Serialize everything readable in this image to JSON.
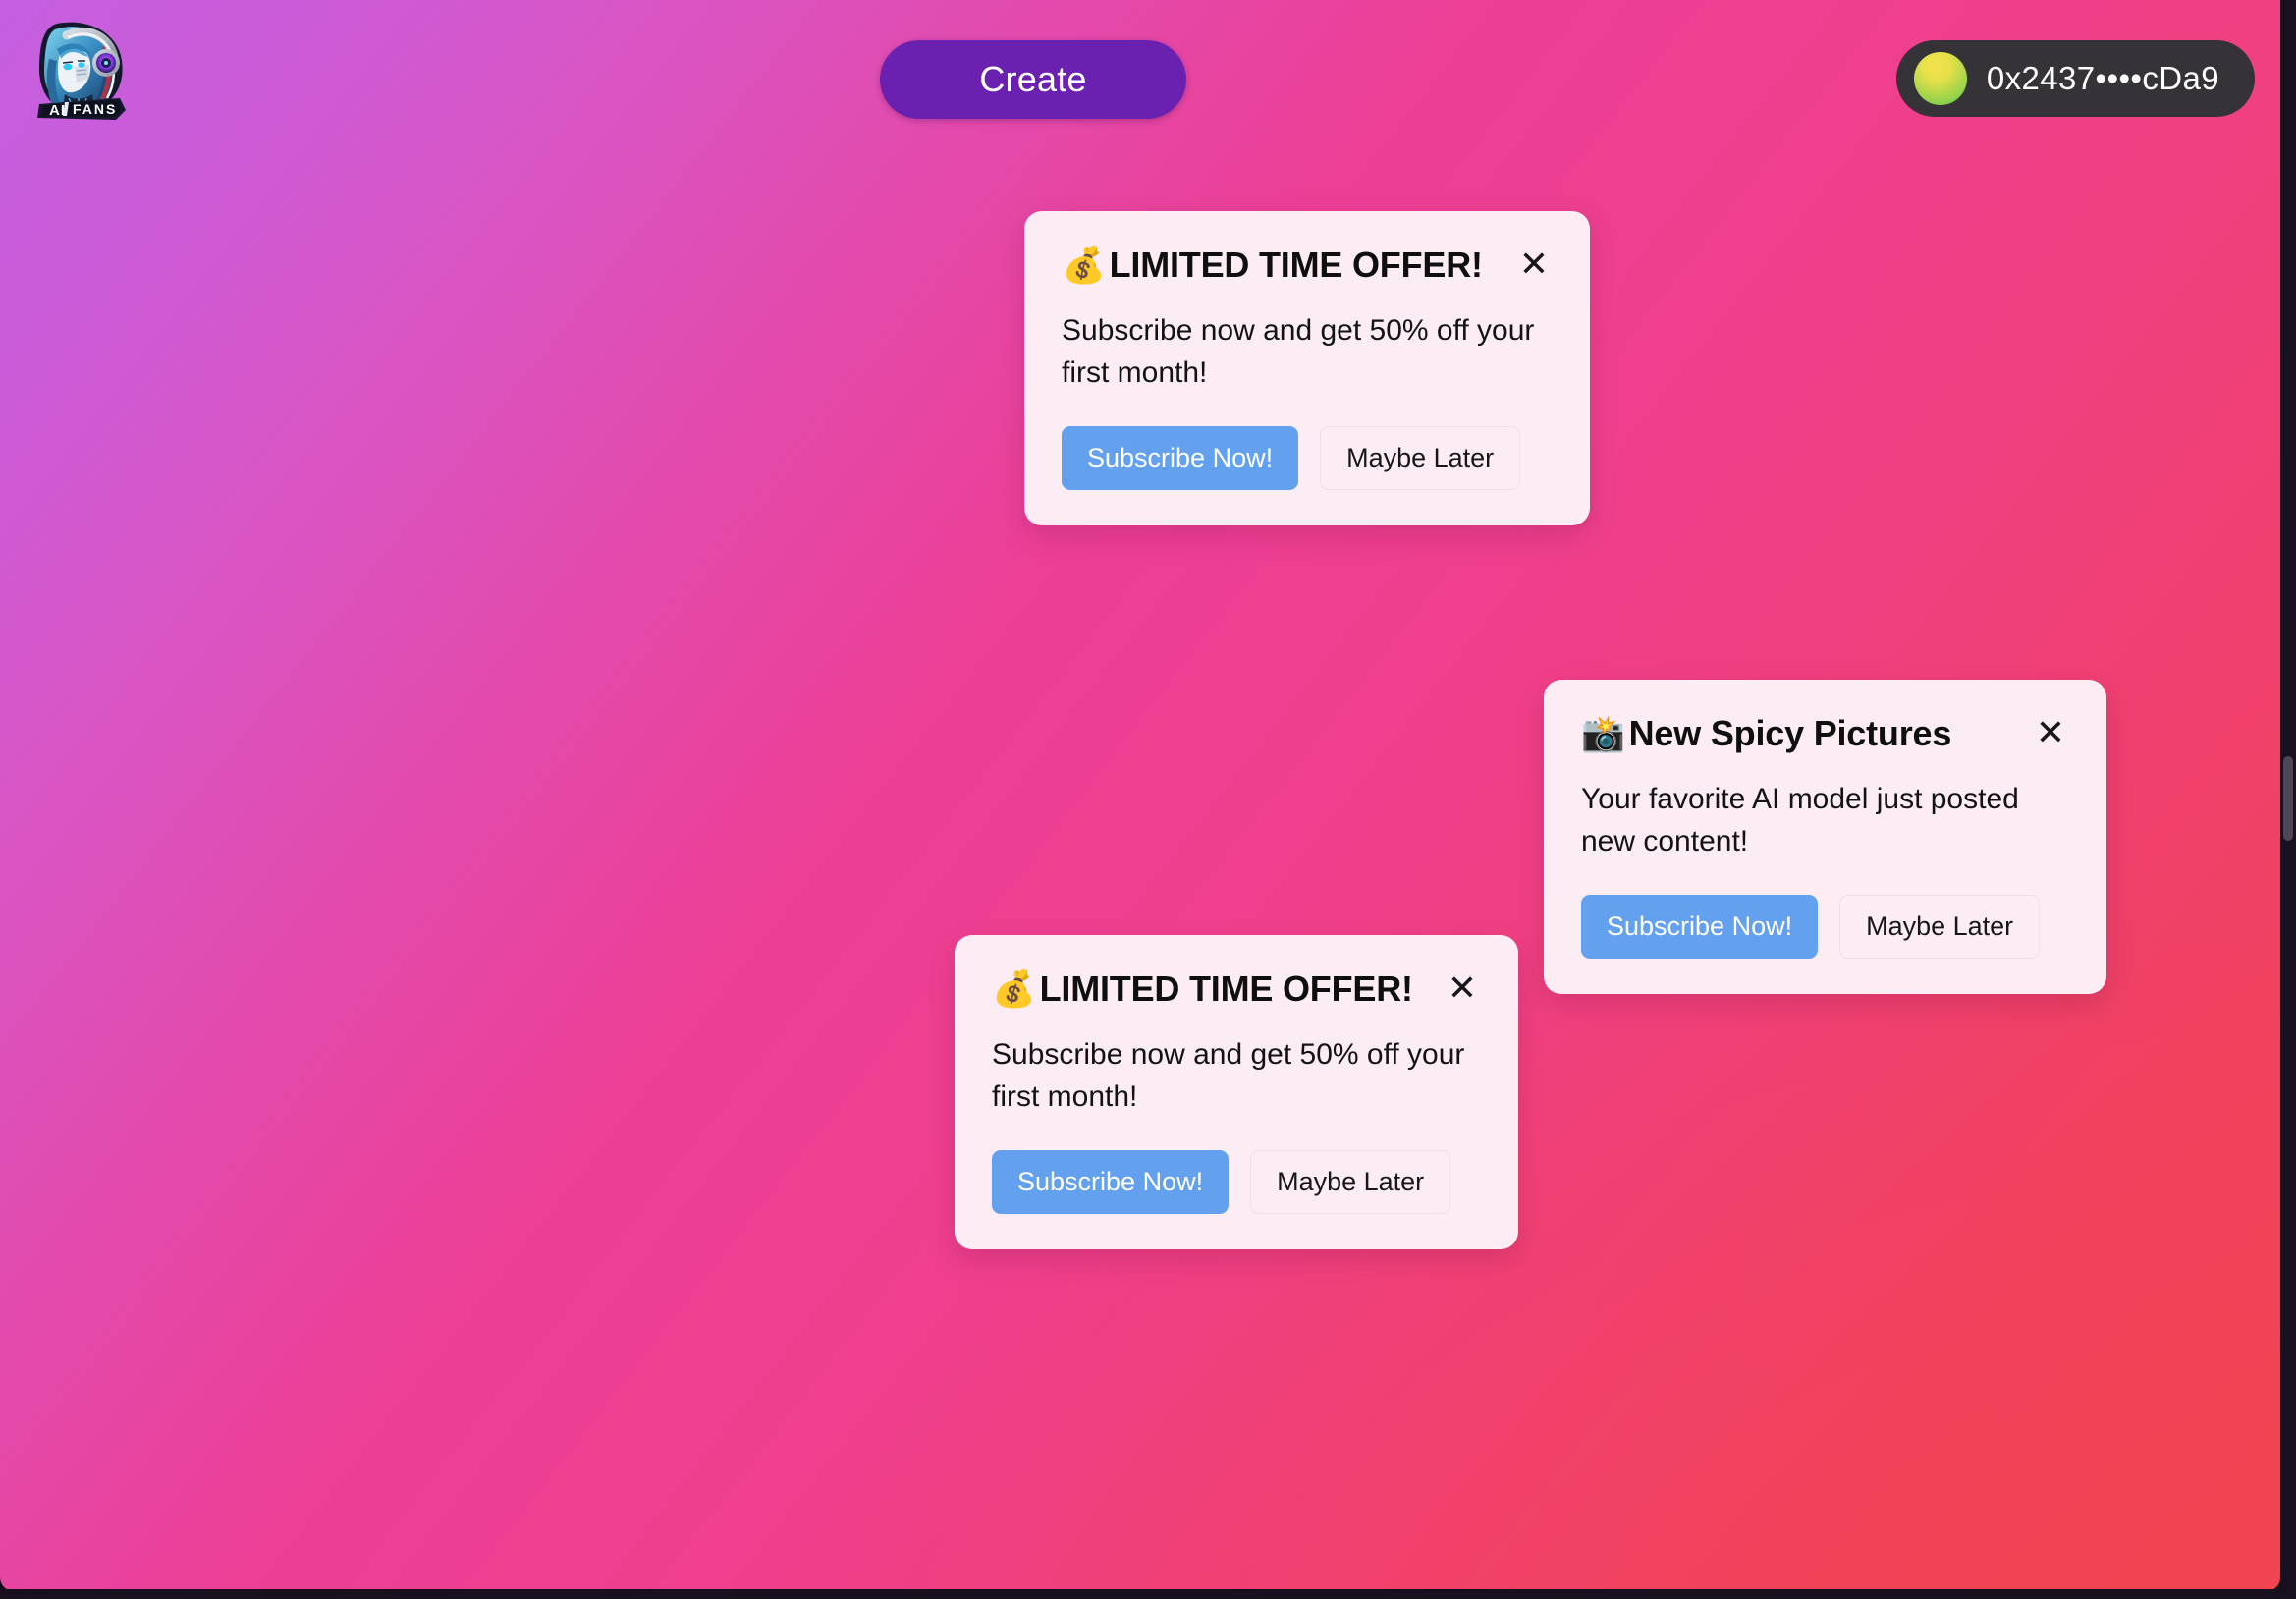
{
  "header": {
    "logo": {
      "icon": "ai-fans-logo",
      "wordmark": "AI FANS",
      "alt": "AI FANS anime cyberpunk character logo"
    },
    "create_label": "Create",
    "wallet": {
      "address": "0x2437••••cDa9",
      "avatar_icon": "wallet-avatar-gradient-circle"
    }
  },
  "colors": {
    "background_start": "#c45fe0",
    "background_mid": "#ec3f95",
    "background_end": "#ee4354",
    "create_button": "#6b21b0",
    "wallet_pill": "#353337",
    "toast_surface": "#fcedf4",
    "primary_button": "#63a1ee",
    "text_dark": "#0f0f10",
    "chrome_dark": "#19101f",
    "scrollbar_thumb": "#4e4656"
  },
  "toasts": [
    {
      "emoji": "💰",
      "title": "LIMITED TIME OFFER!",
      "body": "Subscribe now and get 50% off your first month!",
      "primary_label": "Subscribe Now!",
      "secondary_label": "Maybe Later",
      "close_label": "✕"
    },
    {
      "emoji": "📸",
      "title": "New Spicy Pictures",
      "body": "Your favorite AI model just posted new content!",
      "primary_label": "Subscribe Now!",
      "secondary_label": "Maybe Later",
      "close_label": "✕"
    },
    {
      "emoji": "💰",
      "title": "LIMITED TIME OFFER!",
      "body": "Subscribe now and get 50% off your first month!",
      "primary_label": "Subscribe Now!",
      "secondary_label": "Maybe Later",
      "close_label": "✕"
    }
  ]
}
